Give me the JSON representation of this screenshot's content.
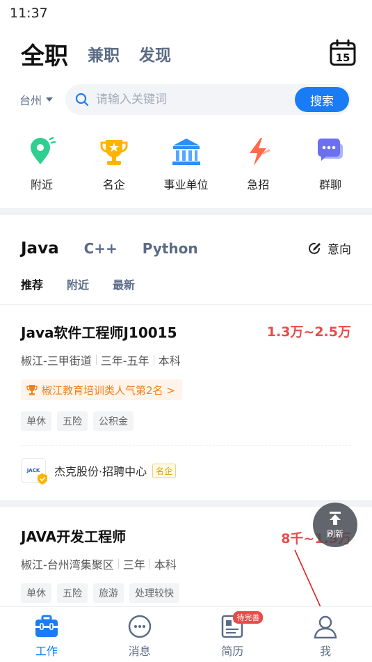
{
  "status_bar": {
    "time": "11:37"
  },
  "top_tabs": [
    {
      "label": "全职",
      "active": true
    },
    {
      "label": "兼职",
      "active": false
    },
    {
      "label": "发现",
      "active": false
    }
  ],
  "calendar_day": "15",
  "search": {
    "city": "台州",
    "placeholder": "请输入关键词",
    "button": "搜索"
  },
  "quick_links": [
    {
      "label": "附近",
      "icon": "location-pin-icon"
    },
    {
      "label": "名企",
      "icon": "trophy-icon"
    },
    {
      "label": "事业单位",
      "icon": "bank-building-icon"
    },
    {
      "label": "急招",
      "icon": "lightning-icon"
    },
    {
      "label": "群聊",
      "icon": "chat-bubble-icon"
    }
  ],
  "lang_tabs": [
    {
      "label": "Java",
      "active": true
    },
    {
      "label": "C++",
      "active": false
    },
    {
      "label": "Python",
      "active": false
    }
  ],
  "intent_label": "意向",
  "sub_tabs": [
    {
      "label": "推荐",
      "active": true
    },
    {
      "label": "附近",
      "active": false
    },
    {
      "label": "最新",
      "active": false
    }
  ],
  "jobs": [
    {
      "title": "Java软件工程师J10015",
      "salary": "1.3万~2.5万",
      "location": "椒江-三甲街道",
      "experience": "三年-五年",
      "education": "本科",
      "rank": "椒江教育培训类人气第2名 >",
      "tags": [
        "单休",
        "五险",
        "公积金"
      ],
      "company": "杰克股份·招聘中心",
      "company_badge": "名企",
      "logo_text": "JACK"
    },
    {
      "title": "JAVA开发工程师",
      "salary": "8千~1.5万",
      "location": "椒江-台州湾集聚区",
      "experience": "三年",
      "education": "本科",
      "tags": [
        "单休",
        "五险",
        "旅游",
        "处理较快"
      ]
    }
  ],
  "refresh_label": "刷新",
  "bottom_nav": [
    {
      "label": "工作",
      "active": true
    },
    {
      "label": "消息",
      "active": false
    },
    {
      "label": "简历",
      "active": false,
      "badge": "待完善"
    },
    {
      "label": "我",
      "active": false
    }
  ],
  "colors": {
    "accent": "#1a7cf5",
    "salary": "#e84a4a",
    "rank": "#f0801e"
  }
}
